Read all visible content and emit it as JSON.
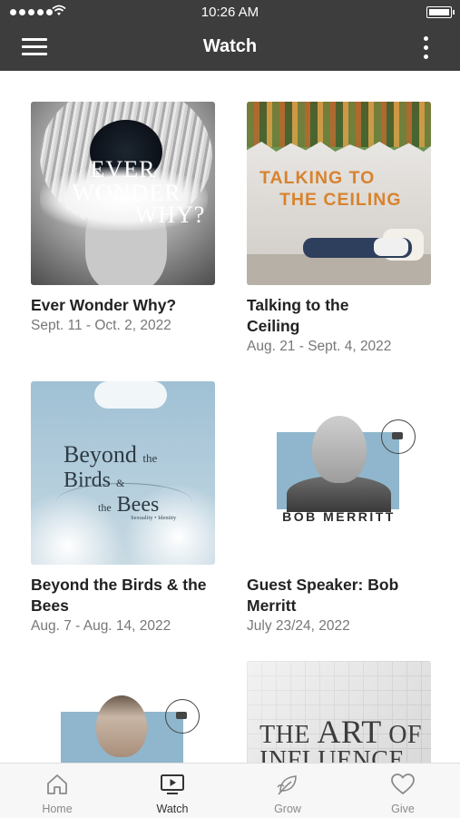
{
  "status_bar": {
    "time": "10:26 AM"
  },
  "nav": {
    "title": "Watch"
  },
  "cards": [
    {
      "title": "Ever Wonder Why?",
      "date": "Sept. 11 - Oct. 2, 2022",
      "art": {
        "line1": "EVER",
        "line2": "WONDER",
        "line3": "WHY?"
      }
    },
    {
      "title": "Talking to the Ceiling",
      "date": "Aug. 21 - Sept. 4, 2022",
      "art": {
        "line1": "TALKING TO",
        "line2": "THE CEILING"
      }
    },
    {
      "title": "Beyond the Birds & the Bees",
      "date": "Aug. 7 - Aug. 14, 2022",
      "art": {
        "line1": "Beyond",
        "line1b": "the",
        "line2": "Birds",
        "line2b": "&",
        "line3": "the",
        "line3b": "Bees",
        "sub": "Sexuality • Identity"
      }
    },
    {
      "title": "Guest Speaker: Bob Merritt",
      "date": "July 23/24, 2022",
      "art": {
        "name": "BOB MERRITT"
      }
    },
    {
      "title": "",
      "date": "",
      "art": {}
    },
    {
      "title": "",
      "date": "",
      "art": {
        "line1": "THE",
        "line1b": "ART",
        "line1c": "OF",
        "line2": "INFLUENCE"
      }
    }
  ],
  "tabs": [
    {
      "label": "Home",
      "icon": "home-icon",
      "active": false
    },
    {
      "label": "Watch",
      "icon": "tv-play-icon",
      "active": true
    },
    {
      "label": "Grow",
      "icon": "leaf-icon",
      "active": false
    },
    {
      "label": "Give",
      "icon": "heart-icon",
      "active": false
    }
  ],
  "colors": {
    "nav_bar": "#3d3d3d",
    "tab_bar": "#f7f7f7",
    "title_text": "#222222",
    "date_text": "#777777"
  }
}
